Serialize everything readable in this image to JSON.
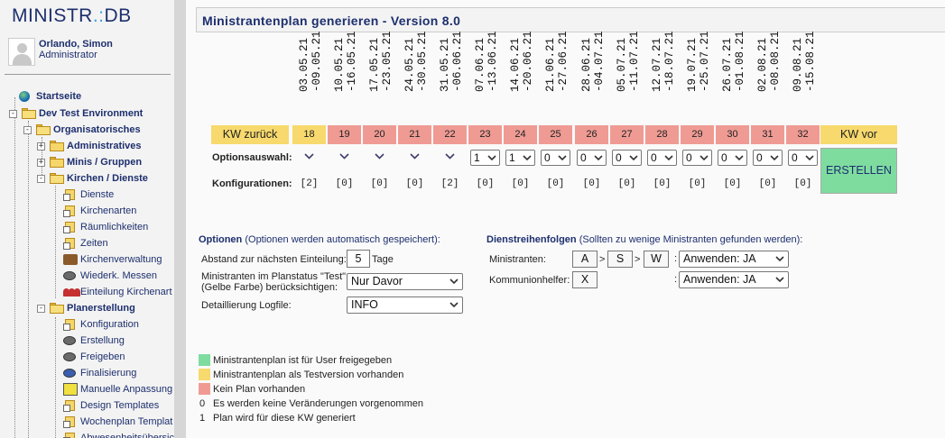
{
  "app": {
    "logo": "MINISTR.:DB",
    "logo_main": "MINISTR",
    "logo_dot": ".:",
    "logo_rest": "DB"
  },
  "user": {
    "name": "Orlando, Simon",
    "role": "Administrator"
  },
  "sidebar": {
    "items": [
      {
        "label": "Startseite"
      },
      {
        "label": "Dev Test Environment"
      },
      {
        "label": "Organisatorisches"
      },
      {
        "label": "Administratives"
      },
      {
        "label": "Minis / Gruppen"
      },
      {
        "label": "Kirchen / Dienste"
      },
      {
        "label": "Dienste"
      },
      {
        "label": "Kirchenarten"
      },
      {
        "label": "Räumlichkeiten"
      },
      {
        "label": "Zeiten"
      },
      {
        "label": "Kirchenverwaltung"
      },
      {
        "label": "Wiederk. Messen"
      },
      {
        "label": "Einteilung Kirchenart"
      },
      {
        "label": "Planerstellung"
      },
      {
        "label": "Konfiguration"
      },
      {
        "label": "Erstellung"
      },
      {
        "label": "Freigeben"
      },
      {
        "label": "Finalisierung"
      },
      {
        "label": "Manuelle Anpassung"
      },
      {
        "label": "Design Templates"
      },
      {
        "label": "Wochenplan Templat"
      },
      {
        "label": "Abwesenheitsübersic"
      }
    ]
  },
  "page": {
    "title": "Ministrantenplan generieren - Version 8.0"
  },
  "weeks": {
    "nav_back": "KW zurück",
    "nav_forward": "KW vor",
    "row_options_label": "Optionsauswahl:",
    "row_config_label": "Konfigurationen:",
    "create_label": "ERSTELLEN",
    "items": [
      {
        "kw": "18",
        "range": "03.05.21\n-09.05.21",
        "status": "test",
        "option": null,
        "config": "[2]"
      },
      {
        "kw": "19",
        "range": "10.05.21\n-16.05.21",
        "status": "none",
        "option": null,
        "config": "[0]"
      },
      {
        "kw": "20",
        "range": "17.05.21\n-23.05.21",
        "status": "none",
        "option": null,
        "config": "[0]"
      },
      {
        "kw": "21",
        "range": "24.05.21\n-30.05.21",
        "status": "none",
        "option": null,
        "config": "[0]"
      },
      {
        "kw": "22",
        "range": "31.05.21\n-06.06.21",
        "status": "none",
        "option": null,
        "config": "[2]"
      },
      {
        "kw": "23",
        "range": "07.06.21\n-13.06.21",
        "status": "none",
        "option": "1",
        "config": "[0]"
      },
      {
        "kw": "24",
        "range": "14.06.21\n-20.06.21",
        "status": "none",
        "option": "1",
        "config": "[0]"
      },
      {
        "kw": "25",
        "range": "21.06.21\n-27.06.21",
        "status": "none",
        "option": "0",
        "config": "[0]"
      },
      {
        "kw": "26",
        "range": "28.06.21\n-04.07.21",
        "status": "none",
        "option": "0",
        "config": "[0]"
      },
      {
        "kw": "27",
        "range": "05.07.21\n-11.07.21",
        "status": "none",
        "option": "0",
        "config": "[0]"
      },
      {
        "kw": "28",
        "range": "12.07.21\n-18.07.21",
        "status": "none",
        "option": "0",
        "config": "[0]"
      },
      {
        "kw": "29",
        "range": "19.07.21\n-25.07.21",
        "status": "none",
        "option": "0",
        "config": "[0]"
      },
      {
        "kw": "30",
        "range": "26.07.21\n-01.08.21",
        "status": "none",
        "option": "0",
        "config": "[0]"
      },
      {
        "kw": "31",
        "range": "02.08.21\n-08.08.21",
        "status": "none",
        "option": "0",
        "config": "[0]"
      },
      {
        "kw": "32",
        "range": "09.08.21\n-15.08.21",
        "status": "none",
        "option": "0",
        "config": "[0]"
      }
    ]
  },
  "options": {
    "title": "Optionen",
    "subtitle": "(Optionen werden automatisch gespeichert):",
    "distance_label": "Abstand zur nächsten Einteilung:",
    "distance_value": "5",
    "distance_unit": "Tage",
    "test_label_1": "Ministranten im Planstatus \"Test\"",
    "test_label_2": "(Gelbe Farbe) berücksichtigen:",
    "test_value": "Nur Davor",
    "log_label": "Detaillierung Logfile:",
    "log_value": "INFO"
  },
  "order": {
    "title": "Dienstreihenfolgen",
    "subtitle": "(Sollten zu wenige Ministranten gefunden werden):",
    "ministranten_label": "Ministranten:",
    "ministranten_seq": [
      "A",
      "S",
      "W"
    ],
    "ministranten_apply": "Anwenden: JA",
    "kommunion_label": "Kommunionhelfer:",
    "kommunion_seq": [
      "X"
    ],
    "kommunion_apply": "Anwenden: JA",
    "separator": ">",
    "colon": ":"
  },
  "legend": {
    "items": [
      {
        "kind": "swatch",
        "color": "#7edc9f",
        "text": "Ministrantenplan ist für User freigegeben"
      },
      {
        "kind": "swatch",
        "color": "#f7d96d",
        "text": "Ministrantenplan als Testversion vorhanden"
      },
      {
        "kind": "swatch",
        "color": "#ef9b94",
        "text": "Kein Plan vorhanden"
      },
      {
        "kind": "code",
        "code": "0",
        "text": "Es werden keine Veränderungen vorgenommen"
      },
      {
        "kind": "code",
        "code": "1",
        "text": "Plan wird für diese KW generiert"
      }
    ]
  },
  "colors": {
    "released": "#7edc9f",
    "test": "#f7d96d",
    "none": "#ef9b94",
    "brand": "#1d2f6e"
  }
}
